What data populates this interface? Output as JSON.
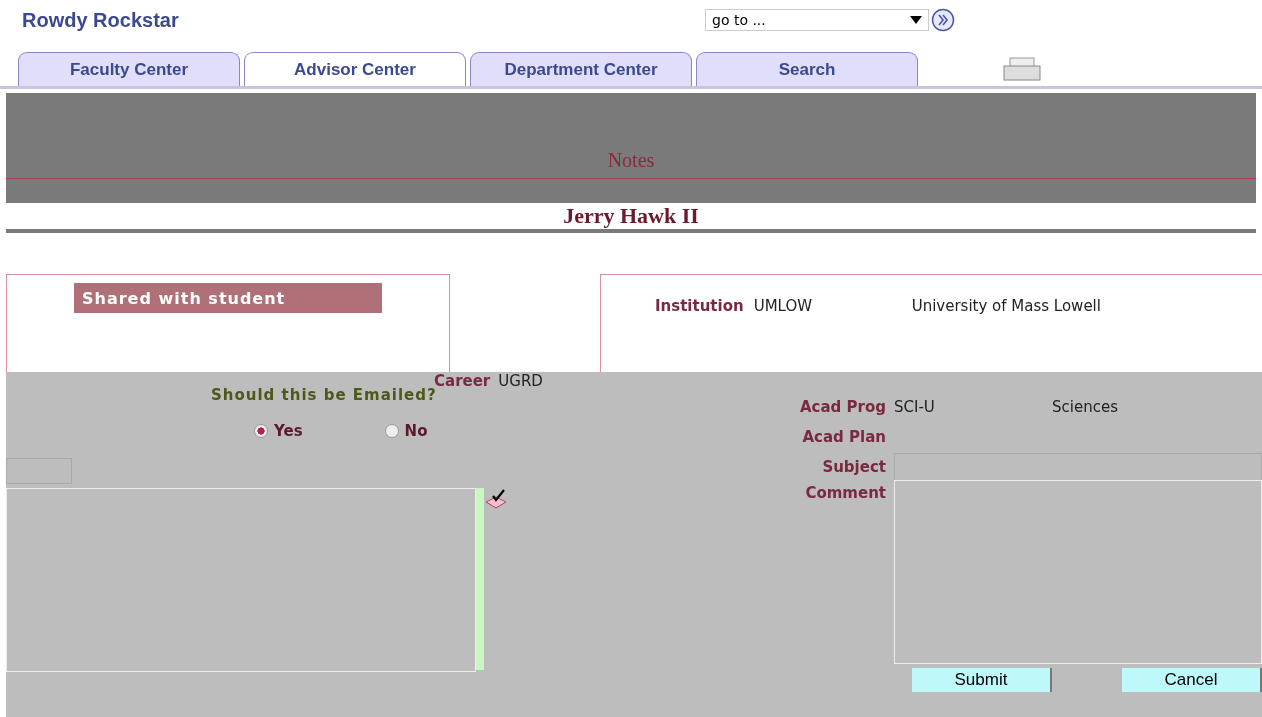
{
  "header": {
    "title": "Rowdy Rockstar",
    "goto": "go to ..."
  },
  "tabs": [
    {
      "label": "Faculty Center",
      "selected": false
    },
    {
      "label": "Advisor Center",
      "selected": true
    },
    {
      "label": "Department Center",
      "selected": false
    },
    {
      "label": "Search",
      "selected": false
    }
  ],
  "page": {
    "title": "Notes",
    "student": "Jerry Hawk II"
  },
  "shared_panel": {
    "heading": "Shared with student"
  },
  "institution": {
    "label": "Institution",
    "code": "UMLOW",
    "name": "University of Mass Lowell"
  },
  "career": {
    "label": "Career",
    "value": "UGRD"
  },
  "email": {
    "question": "Should this be Emailed?",
    "options": [
      {
        "label": "Yes",
        "selected": true
      },
      {
        "label": "No",
        "selected": false
      }
    ]
  },
  "fields": [
    {
      "label": "Acad Prog",
      "code": "SCI-U",
      "name": "Sciences"
    },
    {
      "label": "Acad Plan"
    }
  ],
  "subject": {
    "label": "Subject"
  },
  "comment": {
    "label": "Comment"
  },
  "buttons": [
    "Submit",
    "Cancel"
  ]
}
